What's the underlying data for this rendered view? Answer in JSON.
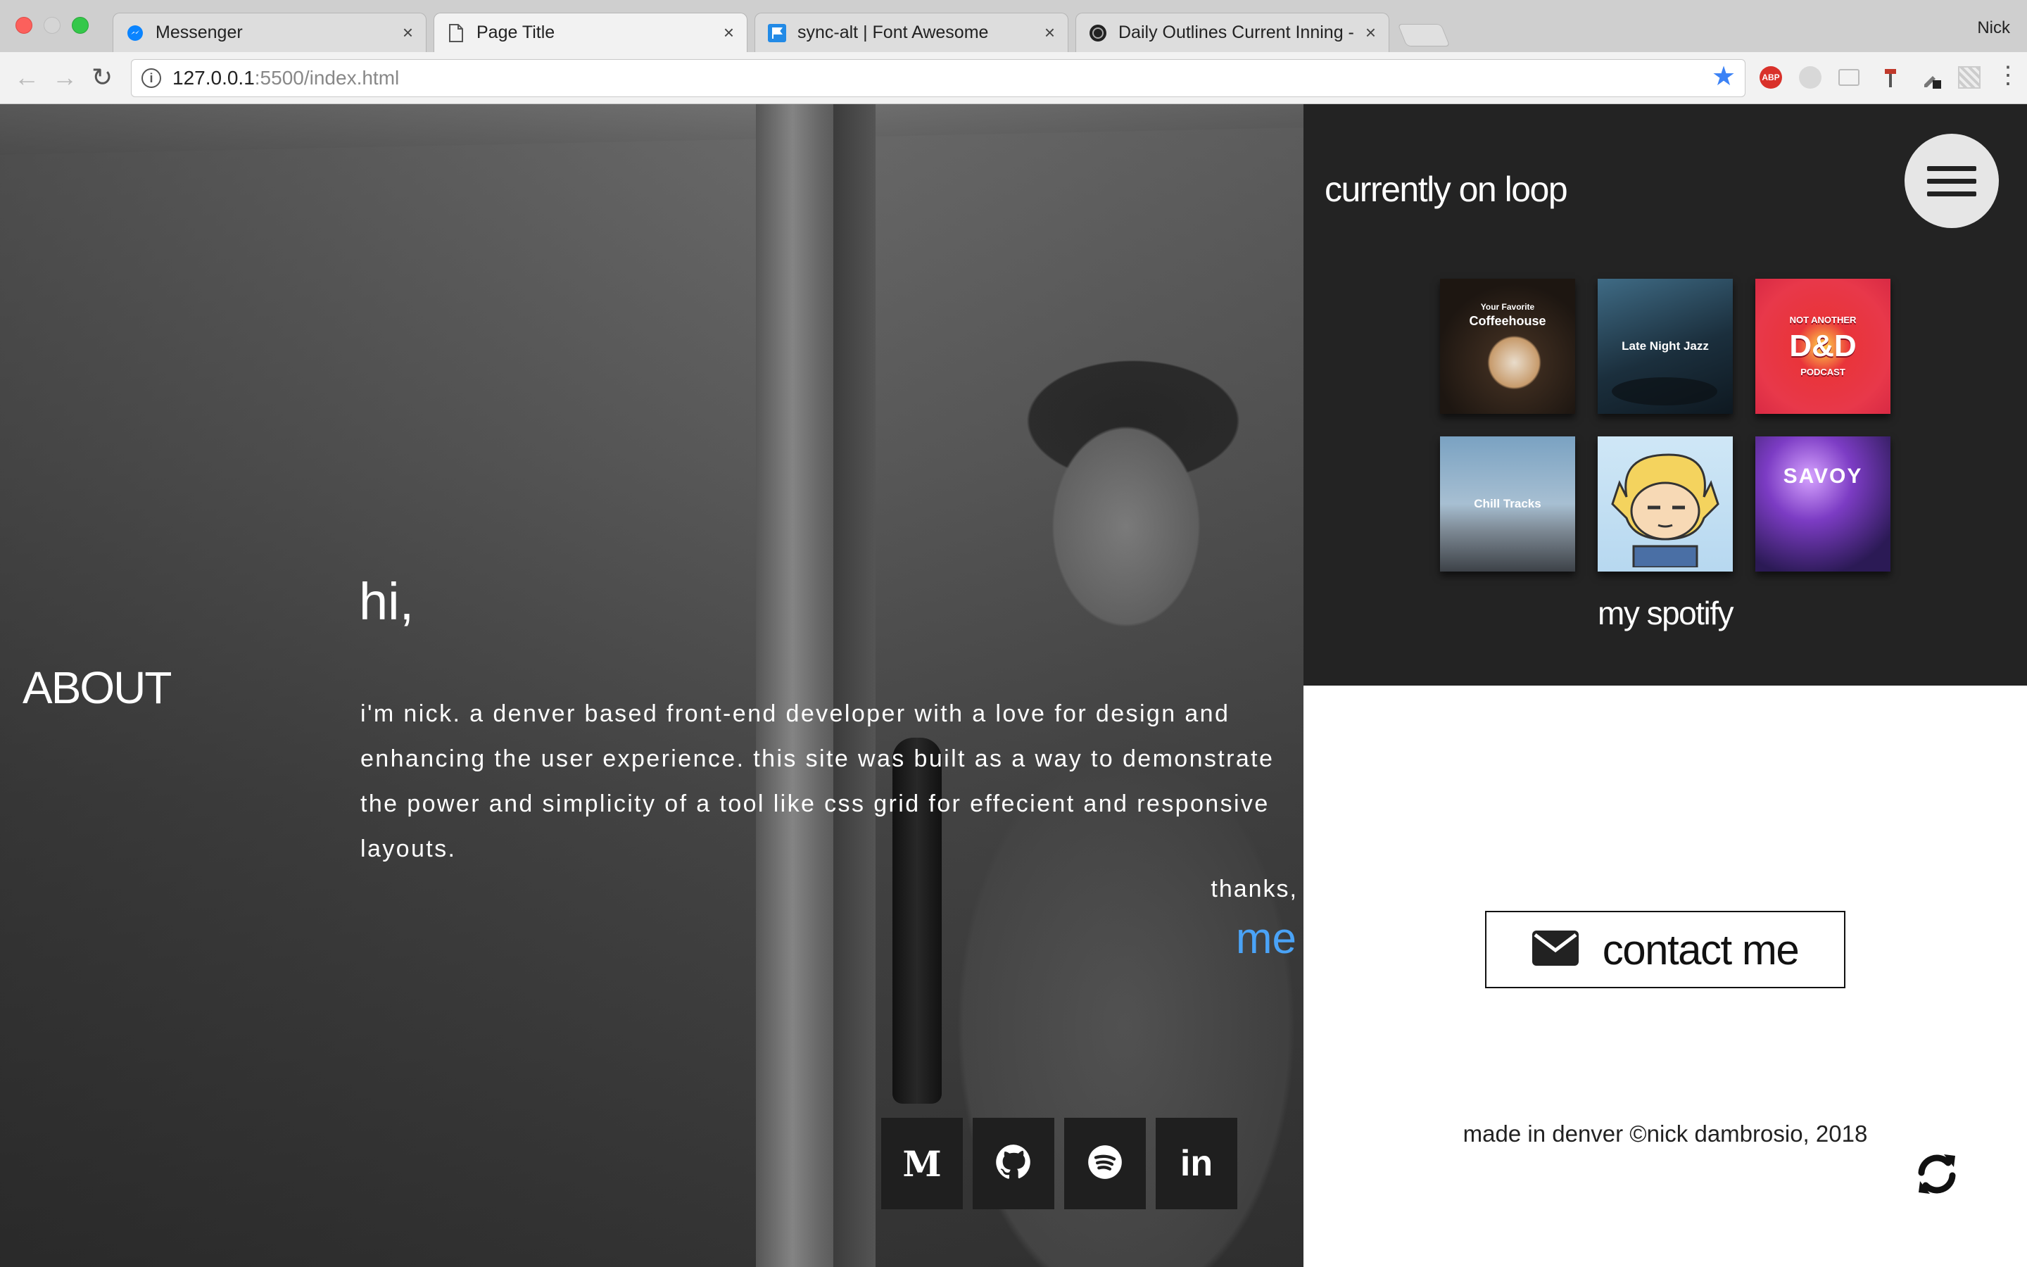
{
  "browser": {
    "tabs": [
      {
        "title": "Messenger",
        "icon": "messenger-icon",
        "active": false
      },
      {
        "title": "Page Title",
        "icon": "page-icon",
        "active": true
      },
      {
        "title": "sync-alt | Font Awesome",
        "icon": "font-awesome-flag-icon",
        "active": false
      },
      {
        "title": "Daily Outlines Current Inning -",
        "icon": "baseball-icon",
        "active": false
      }
    ],
    "profile": "Nick",
    "url_host": "127.0.0.1",
    "url_rest": ":5500/index.html",
    "extension_abp": "ABP"
  },
  "hero": {
    "section_label": "ABOUT",
    "greeting": "hi,",
    "bio": "i'm nick. a denver based front-end developer with a love for design and enhancing the user experience. this site was built as a way to demonstrate the power and simplicity of a tool like css grid for effecient and responsive layouts.",
    "thanks": "thanks,",
    "signature": "me",
    "signature_color": "#4aa3f7",
    "social": [
      "medium-icon",
      "github-icon",
      "spotify-icon",
      "linkedin-icon"
    ],
    "social_medium_glyph": "M",
    "social_linkedin_glyph": "in"
  },
  "loop": {
    "title": "currently on loop",
    "albums": [
      {
        "name": "Your Favorite Coffeehouse",
        "line1": "Your Favorite",
        "line2": "Coffeehouse"
      },
      {
        "name": "Late Night Jazz"
      },
      {
        "name": "Not Another D&D Podcast",
        "line1": "NOT ANOTHER",
        "line2": "D&D",
        "line3": "PODCAST"
      },
      {
        "name": "Chill Tracks"
      },
      {
        "name": "cartoon avatar album"
      },
      {
        "name": "SAVOY"
      }
    ],
    "spotify_label": "my spotify"
  },
  "contact": {
    "label": "contact me",
    "icon": "envelope-icon"
  },
  "footer": {
    "text": "made in denver ©nick dambrosio, 2018",
    "icon": "sync-icon"
  }
}
